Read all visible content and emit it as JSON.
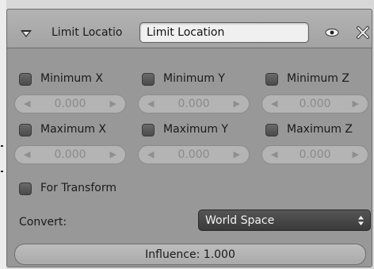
{
  "constraint": {
    "header_label": "Limit Locatio",
    "name_value": "Limit Location"
  },
  "limits": {
    "min_x": {
      "label": "Minimum X",
      "value": "0.000"
    },
    "min_y": {
      "label": "Minimum Y",
      "value": "0.000"
    },
    "min_z": {
      "label": "Minimum Z",
      "value": "0.000"
    },
    "max_x": {
      "label": "Maximum X",
      "value": "0.000"
    },
    "max_y": {
      "label": "Maximum Y",
      "value": "0.000"
    },
    "max_z": {
      "label": "Maximum Z",
      "value": "0.000"
    }
  },
  "for_transform_label": "For Transform",
  "convert": {
    "label": "Convert:",
    "value": "World Space"
  },
  "influence": {
    "text": "Influence: 1.000"
  },
  "icons": {
    "collapse": "triangle-down-icon",
    "visibility": "eye-icon",
    "delete": "close-icon",
    "dropdown": "up-down-arrows-icon"
  },
  "colors": {
    "panel_bg": "#989898",
    "header_bg": "#a9a9a9",
    "checkbox": "#555555",
    "dropdown_bg": "#444444"
  }
}
